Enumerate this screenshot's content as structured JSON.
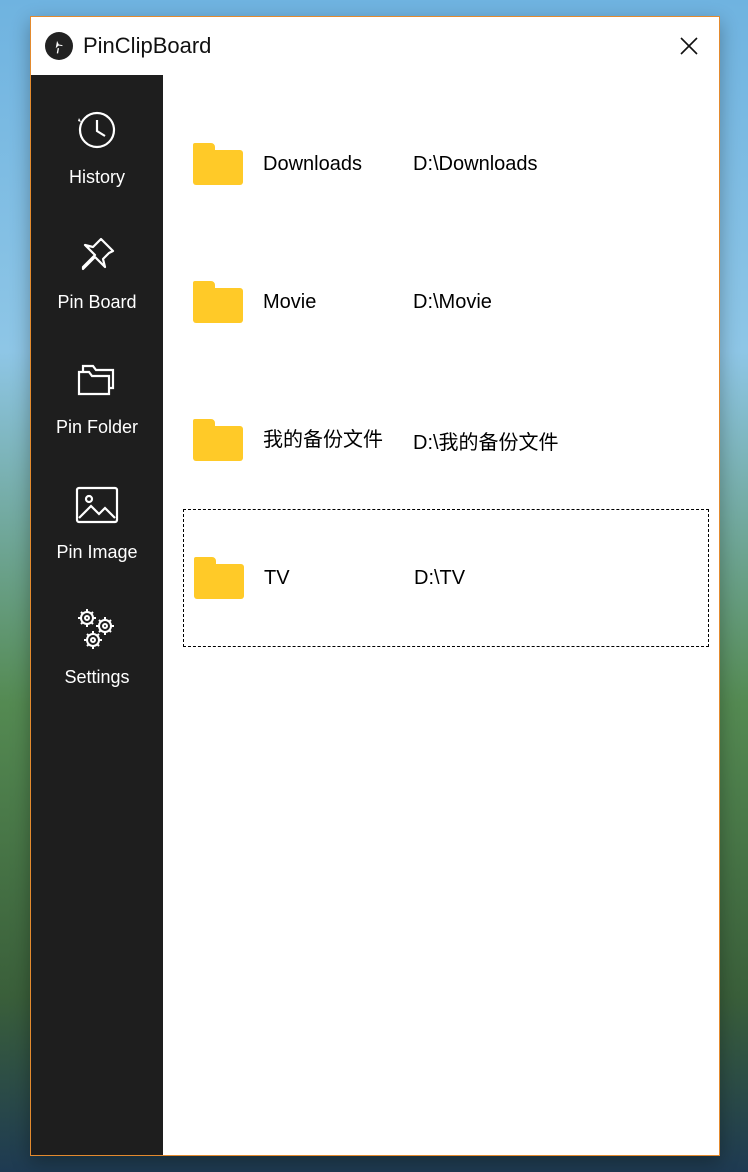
{
  "app": {
    "title": "PinClipBoard"
  },
  "sidebar": {
    "items": [
      {
        "label": "History"
      },
      {
        "label": "Pin Board"
      },
      {
        "label": "Pin Folder"
      },
      {
        "label": "Pin Image"
      },
      {
        "label": "Settings"
      }
    ]
  },
  "folders": [
    {
      "name": "Downloads",
      "path": "D:\\Downloads",
      "selected": false
    },
    {
      "name": "Movie",
      "path": "D:\\Movie",
      "selected": false
    },
    {
      "name": "我的备份文件",
      "path": "D:\\我的备份文件",
      "selected": false
    },
    {
      "name": "TV",
      "path": "D:\\TV",
      "selected": true
    }
  ]
}
